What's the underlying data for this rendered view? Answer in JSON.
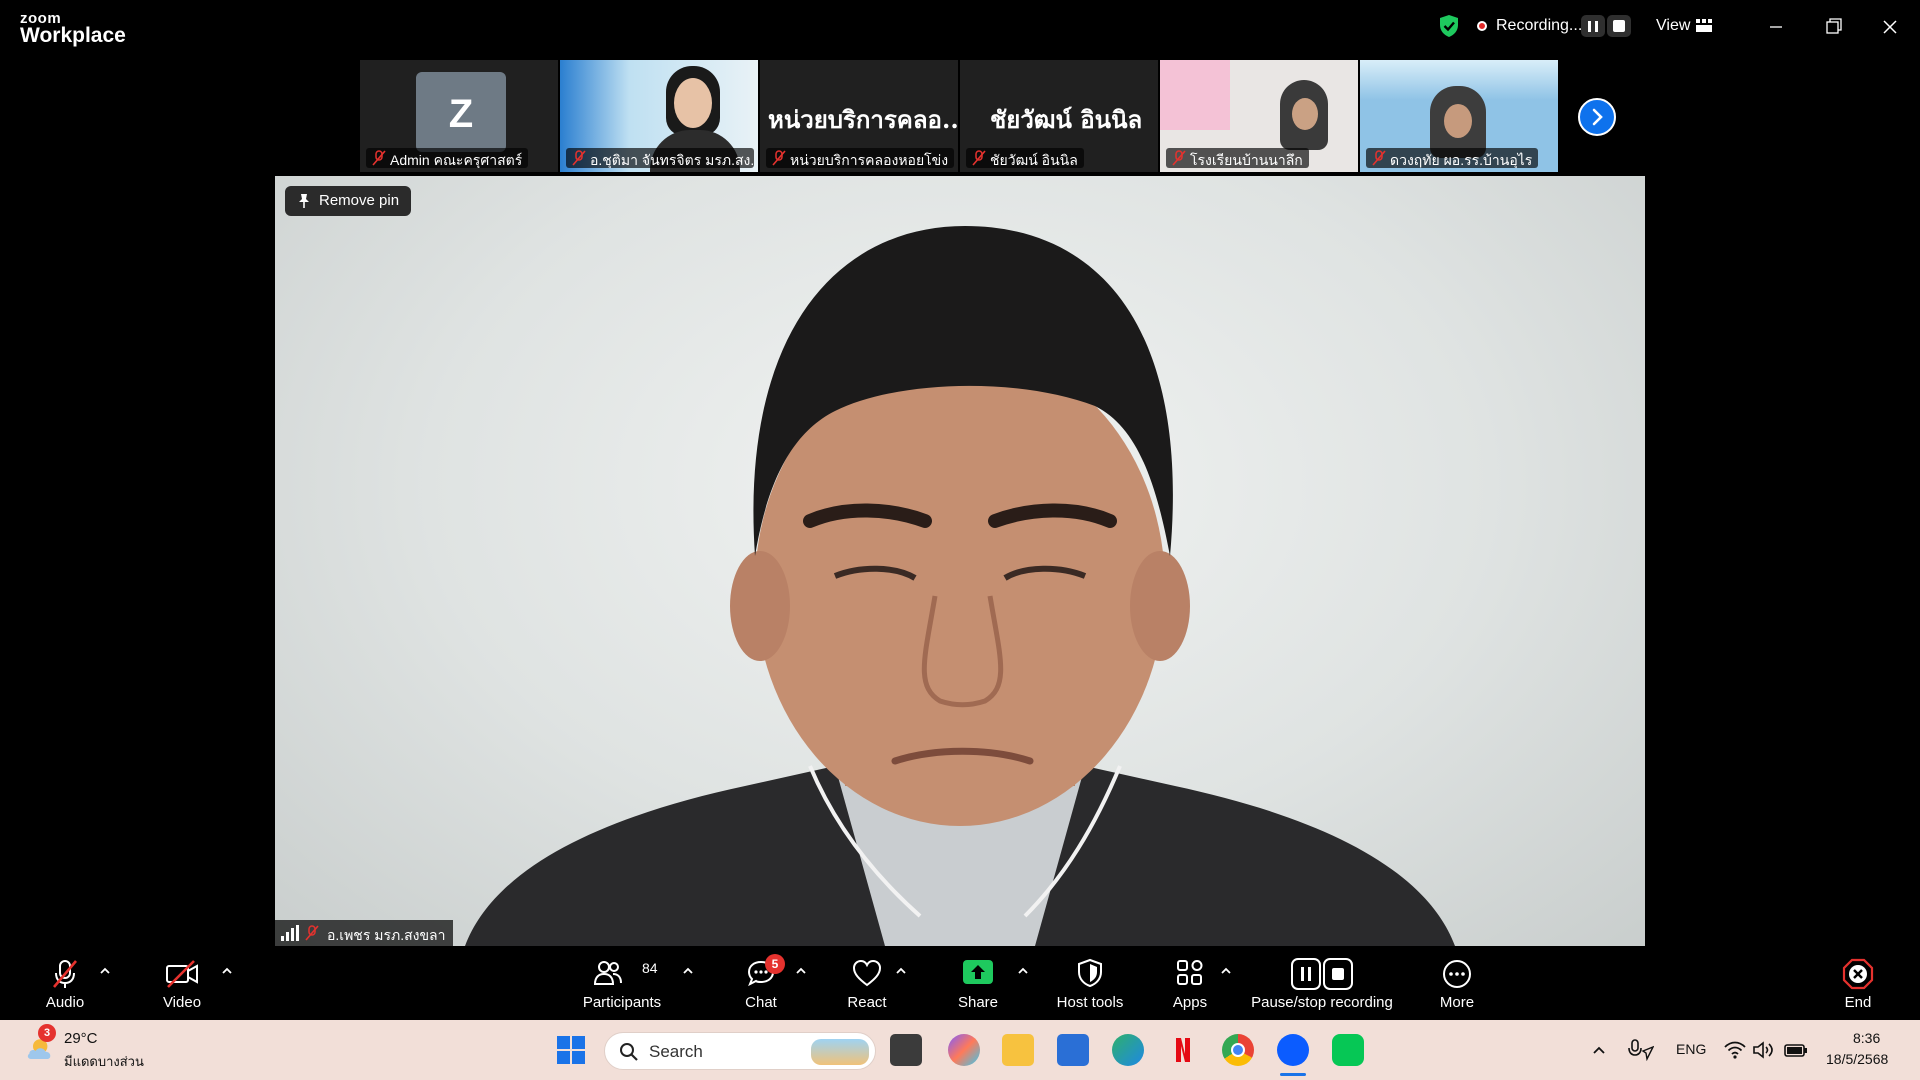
{
  "titlebar": {
    "brand_top": "zoom",
    "brand_bottom": "Workplace",
    "recording_label": "Recording...",
    "view_label": "View"
  },
  "thumbnails": [
    {
      "name": "Admin คณะครุศาสตร์",
      "avatar_letter": "Z"
    },
    {
      "name": "อ.ชุติมา จันทรจิตร มรภ.สง..."
    },
    {
      "name": "หน่วยบริการคลองหอยโข่ง",
      "display_text": "หน่วยบริการคลอ..."
    },
    {
      "name": "ชัยวัฒน์ อินนิล",
      "display_text": "ชัยวัฒน์ อินนิล"
    },
    {
      "name": "โรงเรียนบ้านนาลึก"
    },
    {
      "name": "ดวงฤทัย ผอ.รร.บ้านอุไร"
    }
  ],
  "main_video": {
    "remove_pin_label": "Remove pin",
    "speaker_name": "อ.เพชร มรภ.สงขลา"
  },
  "toolbar": {
    "audio": "Audio",
    "video": "Video",
    "participants": "Participants",
    "participants_count": "84",
    "chat": "Chat",
    "chat_badge": "5",
    "react": "React",
    "share": "Share",
    "host_tools": "Host tools",
    "apps": "Apps",
    "pause_stop_recording": "Pause/stop recording",
    "more": "More",
    "end": "End"
  },
  "taskbar": {
    "weather_badge": "3",
    "temperature": "29°C",
    "weather_desc": "มีแดดบางส่วน",
    "search_placeholder": "Search",
    "language": "ENG",
    "time": "8:36",
    "date": "18/5/2568"
  },
  "colors": {
    "accent_blue": "#0e72ed",
    "share_green": "#1ec95e",
    "end_red": "#e5322e",
    "taskbar_bg": "#f2dfd8"
  }
}
